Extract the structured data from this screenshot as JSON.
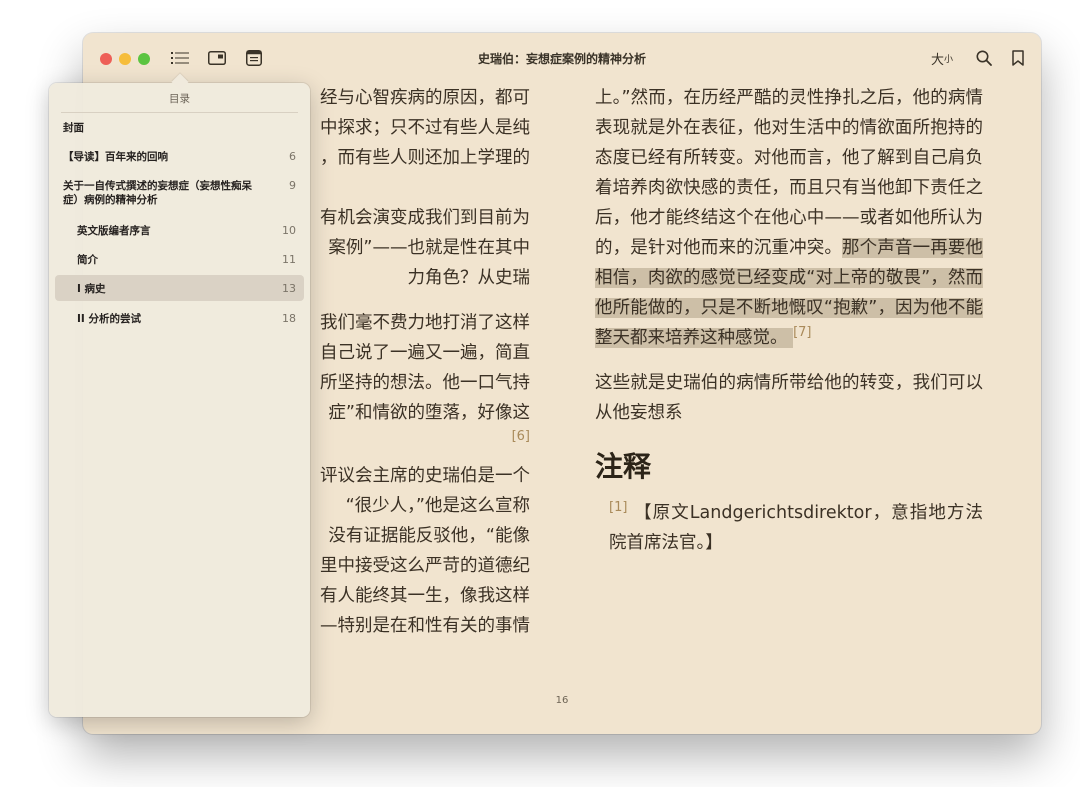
{
  "window": {
    "title": "史瑞伯：妄想症案例的精神分析",
    "font_size_label_big": "大",
    "font_size_label_small": "小"
  },
  "left_column": [
    "经与心智疾病的原因，都可",
    "中探求；只不过有些人是纯",
    "，而有些人则还加上学理的",
    "",
    "有机会演变成我们到目前为",
    "案例”——也就是性在其中",
    "力角色？从史瑞",
    "",
    "我们毫不费力地打消了这样",
    "自己说了一遍又一遍，简直",
    "所坚持的想法。他一口气持",
    "症”和情欲的堕落，好像这",
    "[6]",
    "",
    "评议会主席的史瑞伯是一个",
    "“很少人，”他是这么宣称",
    "没有证据能反驳他，“能像",
    "里中接受这么严苛的道德纪",
    "有人能终其一生，像我这样",
    "—特别是在和性有关的事情"
  ],
  "right_column": {
    "para1_plain": "上。”然而，在历经严酷的灵性挣扎之后，他的病情表现就是外在表征，他对生活中的情欲面所抱持的态度已经有所转变。对他而言，他了解到自己肩负着培养肉欲快感的责任，而且只有当他卸下责任之后，他才能终结这个在他心中——或者如他所认为的，是针对他而来的沉重冲突。",
    "para1_highlight": "那个声音一再要他相信，肉欲的感觉已经变成“对上帝的敬畏”，然而他所能做的，只是不断地慨叹“抱歉”，因为他不能整天都来培养这种感觉。",
    "para1_note": "[7]",
    "para2": "这些就是史瑞伯的病情所带给他的转变，我们可以从他妄想系",
    "notes_heading": "注释",
    "footnote_ref": "[1]",
    "footnote_text": "【原文Landgerichtsdirektor，意指地方法院首席法官。】"
  },
  "page_number": "16",
  "toc": {
    "heading": "目录",
    "items": [
      {
        "label": "封面",
        "page": ""
      },
      {
        "label": "【导读】百年来的回响",
        "page": "6"
      },
      {
        "label": "关于一自传式撰述的妄想症（妄想性痴呆症）病例的精神分析",
        "page": "9"
      },
      {
        "label": "英文版编者序言",
        "page": "10"
      },
      {
        "label": "简介",
        "page": "11"
      },
      {
        "label": "I 病史",
        "page": "13"
      },
      {
        "label": "II 分析的尝试",
        "page": "18"
      }
    ]
  },
  "colors": {
    "page_bg": "#f1e4cf",
    "highlight": "#cdbfa7",
    "close": "#ee5f57",
    "minimize": "#f6bd3b",
    "zoom": "#5cc441"
  }
}
